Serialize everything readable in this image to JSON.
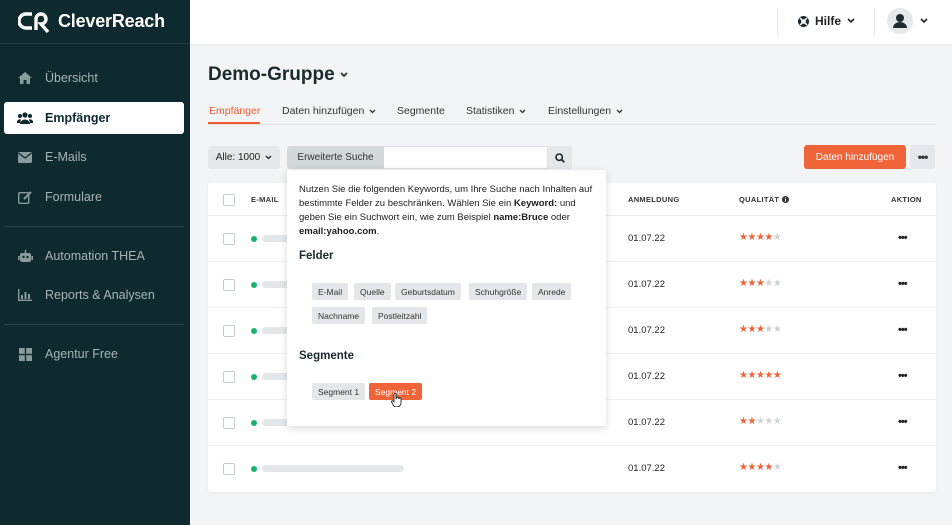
{
  "brand": {
    "name": "CleverReach"
  },
  "sidebar": {
    "items": [
      {
        "label": "Übersicht",
        "icon": "home-icon"
      },
      {
        "label": "Empfänger",
        "icon": "users-icon",
        "active": true
      },
      {
        "label": "E-Mails",
        "icon": "mail-icon"
      },
      {
        "label": "Formulare",
        "icon": "edit-icon"
      },
      {
        "label": "Automation THEA",
        "icon": "robot-icon"
      },
      {
        "label": "Reports & Analysen",
        "icon": "chart-icon"
      },
      {
        "label": "Agentur Free",
        "icon": "grid-icon"
      }
    ]
  },
  "topbar": {
    "help_label": "Hilfe"
  },
  "page": {
    "title": "Demo-Gruppe"
  },
  "tabs": [
    {
      "label": "Empfänger",
      "active": true
    },
    {
      "label": "Daten hinzufügen",
      "dropdown": true
    },
    {
      "label": "Segmente"
    },
    {
      "label": "Statistiken",
      "dropdown": true
    },
    {
      "label": "Einstellungen",
      "dropdown": true
    }
  ],
  "toolbar": {
    "filter_label": "Alle: 1000",
    "advanced_search_label": "Erweiterte Suche",
    "search_value": "",
    "add_data_label": "Daten hinzufügen"
  },
  "table": {
    "headers": {
      "email": "E-MAIL",
      "signup": "ANMELDUNG",
      "quality": "QUALITÄT",
      "action": "AKTION"
    },
    "rows": [
      {
        "date": "01.07.22",
        "stars": 4
      },
      {
        "date": "01.07.22",
        "stars": 3
      },
      {
        "date": "01.07.22",
        "stars": 3
      },
      {
        "date": "01.07.22",
        "stars": 5
      },
      {
        "date": "01.07.22",
        "stars": 2
      },
      {
        "date": "01.07.22",
        "stars": 4
      }
    ],
    "max_stars": 5
  },
  "popover": {
    "intro_1": "Nutzen Sie die folgenden Keywords, um Ihre Suche nach Inhalten auf bestimmte Felder zu beschränken. Wählen Sie ein ",
    "intro_keyword": "Keyword:",
    "intro_2": " und geben Sie ein Suchwort ein, wie zum Beispiel ",
    "intro_example1": "name:Bruce",
    "intro_3": " oder ",
    "intro_example2": "email:yahoo.com",
    "intro_4": ".",
    "fields_heading": "Felder",
    "fields": [
      "E-Mail",
      "Quelle",
      "Geburtsdatum",
      "Schuhgröße",
      "Anrede",
      "Nachname",
      "Postleitzahl"
    ],
    "segments_heading": "Segmente",
    "segments": [
      "Segment 1",
      "Segment 2"
    ]
  },
  "colors": {
    "accent": "#f0643a",
    "sidebar": "#0e2a2e",
    "status_green": "#19b36b"
  }
}
